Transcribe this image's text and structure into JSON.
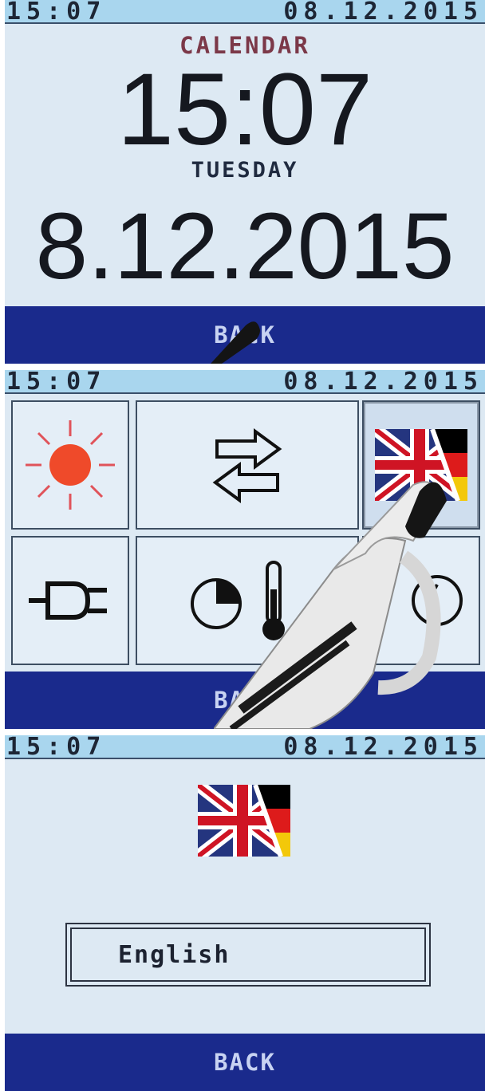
{
  "screens": [
    {
      "status_bar": {
        "time": "15:07",
        "date": "08.12.2015"
      },
      "title": "CALENDAR",
      "time": "15:07",
      "weekday": "TUESDAY",
      "date": "8.12.2015",
      "back_label": "BACK"
    },
    {
      "status_bar": {
        "time": "15:07",
        "date": "08.12.2015"
      },
      "menu_tiles": [
        {
          "icon": "sun-icon"
        },
        {
          "icon": "swap-arrows-icon"
        },
        {
          "icon": "uk-german-flag-icon",
          "selected": true
        },
        {
          "icon": "plug-icon"
        },
        {
          "icon": "timer-thermometer-icon"
        },
        {
          "icon": "clock-icon"
        }
      ],
      "back_label": "BACK"
    },
    {
      "status_bar": {
        "time": "15:07",
        "date": "08.12.2015"
      },
      "flag_icon": "uk-german-flag-icon",
      "language_value": "English",
      "back_label": "BACK"
    }
  ],
  "colors": {
    "screen_bg": "#dde9f3",
    "status_bar_bg": "#a9d6ee",
    "back_bar_bg": "#1a2a8c",
    "calendar_title": "#7b3848",
    "sun": "#ef4a2a"
  }
}
